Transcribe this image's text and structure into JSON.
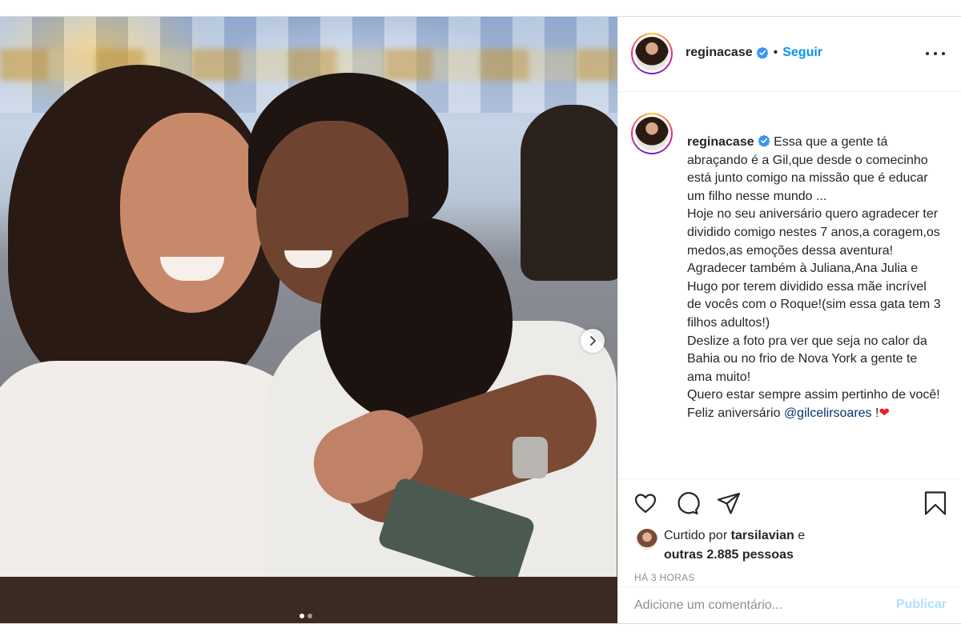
{
  "post": {
    "author": {
      "username": "reginacase",
      "verified": true,
      "separator": "•",
      "follow_label": "Seguir"
    },
    "media": {
      "carousel_dots": 2,
      "active_dot": 1
    },
    "caption": {
      "username": "reginacase",
      "lines": [
        "Essa que a gente tá abraçando é a Gil,que desde o comecinho está junto comigo na missão que é educar um filho nesse mundo ...",
        "Hoje no seu aniversário quero agradecer ter dividido comigo nestes 7 anos,a coragem,os medos,as emoções dessa aventura!",
        "Agradecer também à Juliana,Ana Julia e Hugo por terem dividido essa mãe incrível de vocês com o Roque!(sim essa gata tem 3 filhos adultos!)",
        "Deslize a foto pra ver que seja no calor da Bahia ou no frio de Nova York a gente te ama muito!",
        "Quero estar sempre assim pertinho de você!"
      ],
      "final_text": "Feliz aniversário",
      "mention": "@gilcelirsoares",
      "final_suffix": " !",
      "emoji": "❤"
    },
    "likes": {
      "prefix": "Curtido por",
      "liker": "tarsilavian",
      "conjunction": "e",
      "others": "outras 2.885 pessoas"
    },
    "timestamp": "HÁ 3 HORAS",
    "comment": {
      "placeholder": "Adicione um comentário...",
      "publish_label": "Publicar"
    },
    "icons": {
      "like": "heart-icon",
      "comment": "comment-icon",
      "share": "share-icon",
      "save": "bookmark-icon",
      "more": "more-options-icon",
      "next": "chevron-right-icon",
      "verified": "verified-badge-icon"
    },
    "colors": {
      "accent": "#0095f6",
      "text": "#262626",
      "muted": "#8e8e8e",
      "mention": "#00376b",
      "publish_disabled": "#b2dffc",
      "heart_emoji": "#ed1c24"
    }
  }
}
